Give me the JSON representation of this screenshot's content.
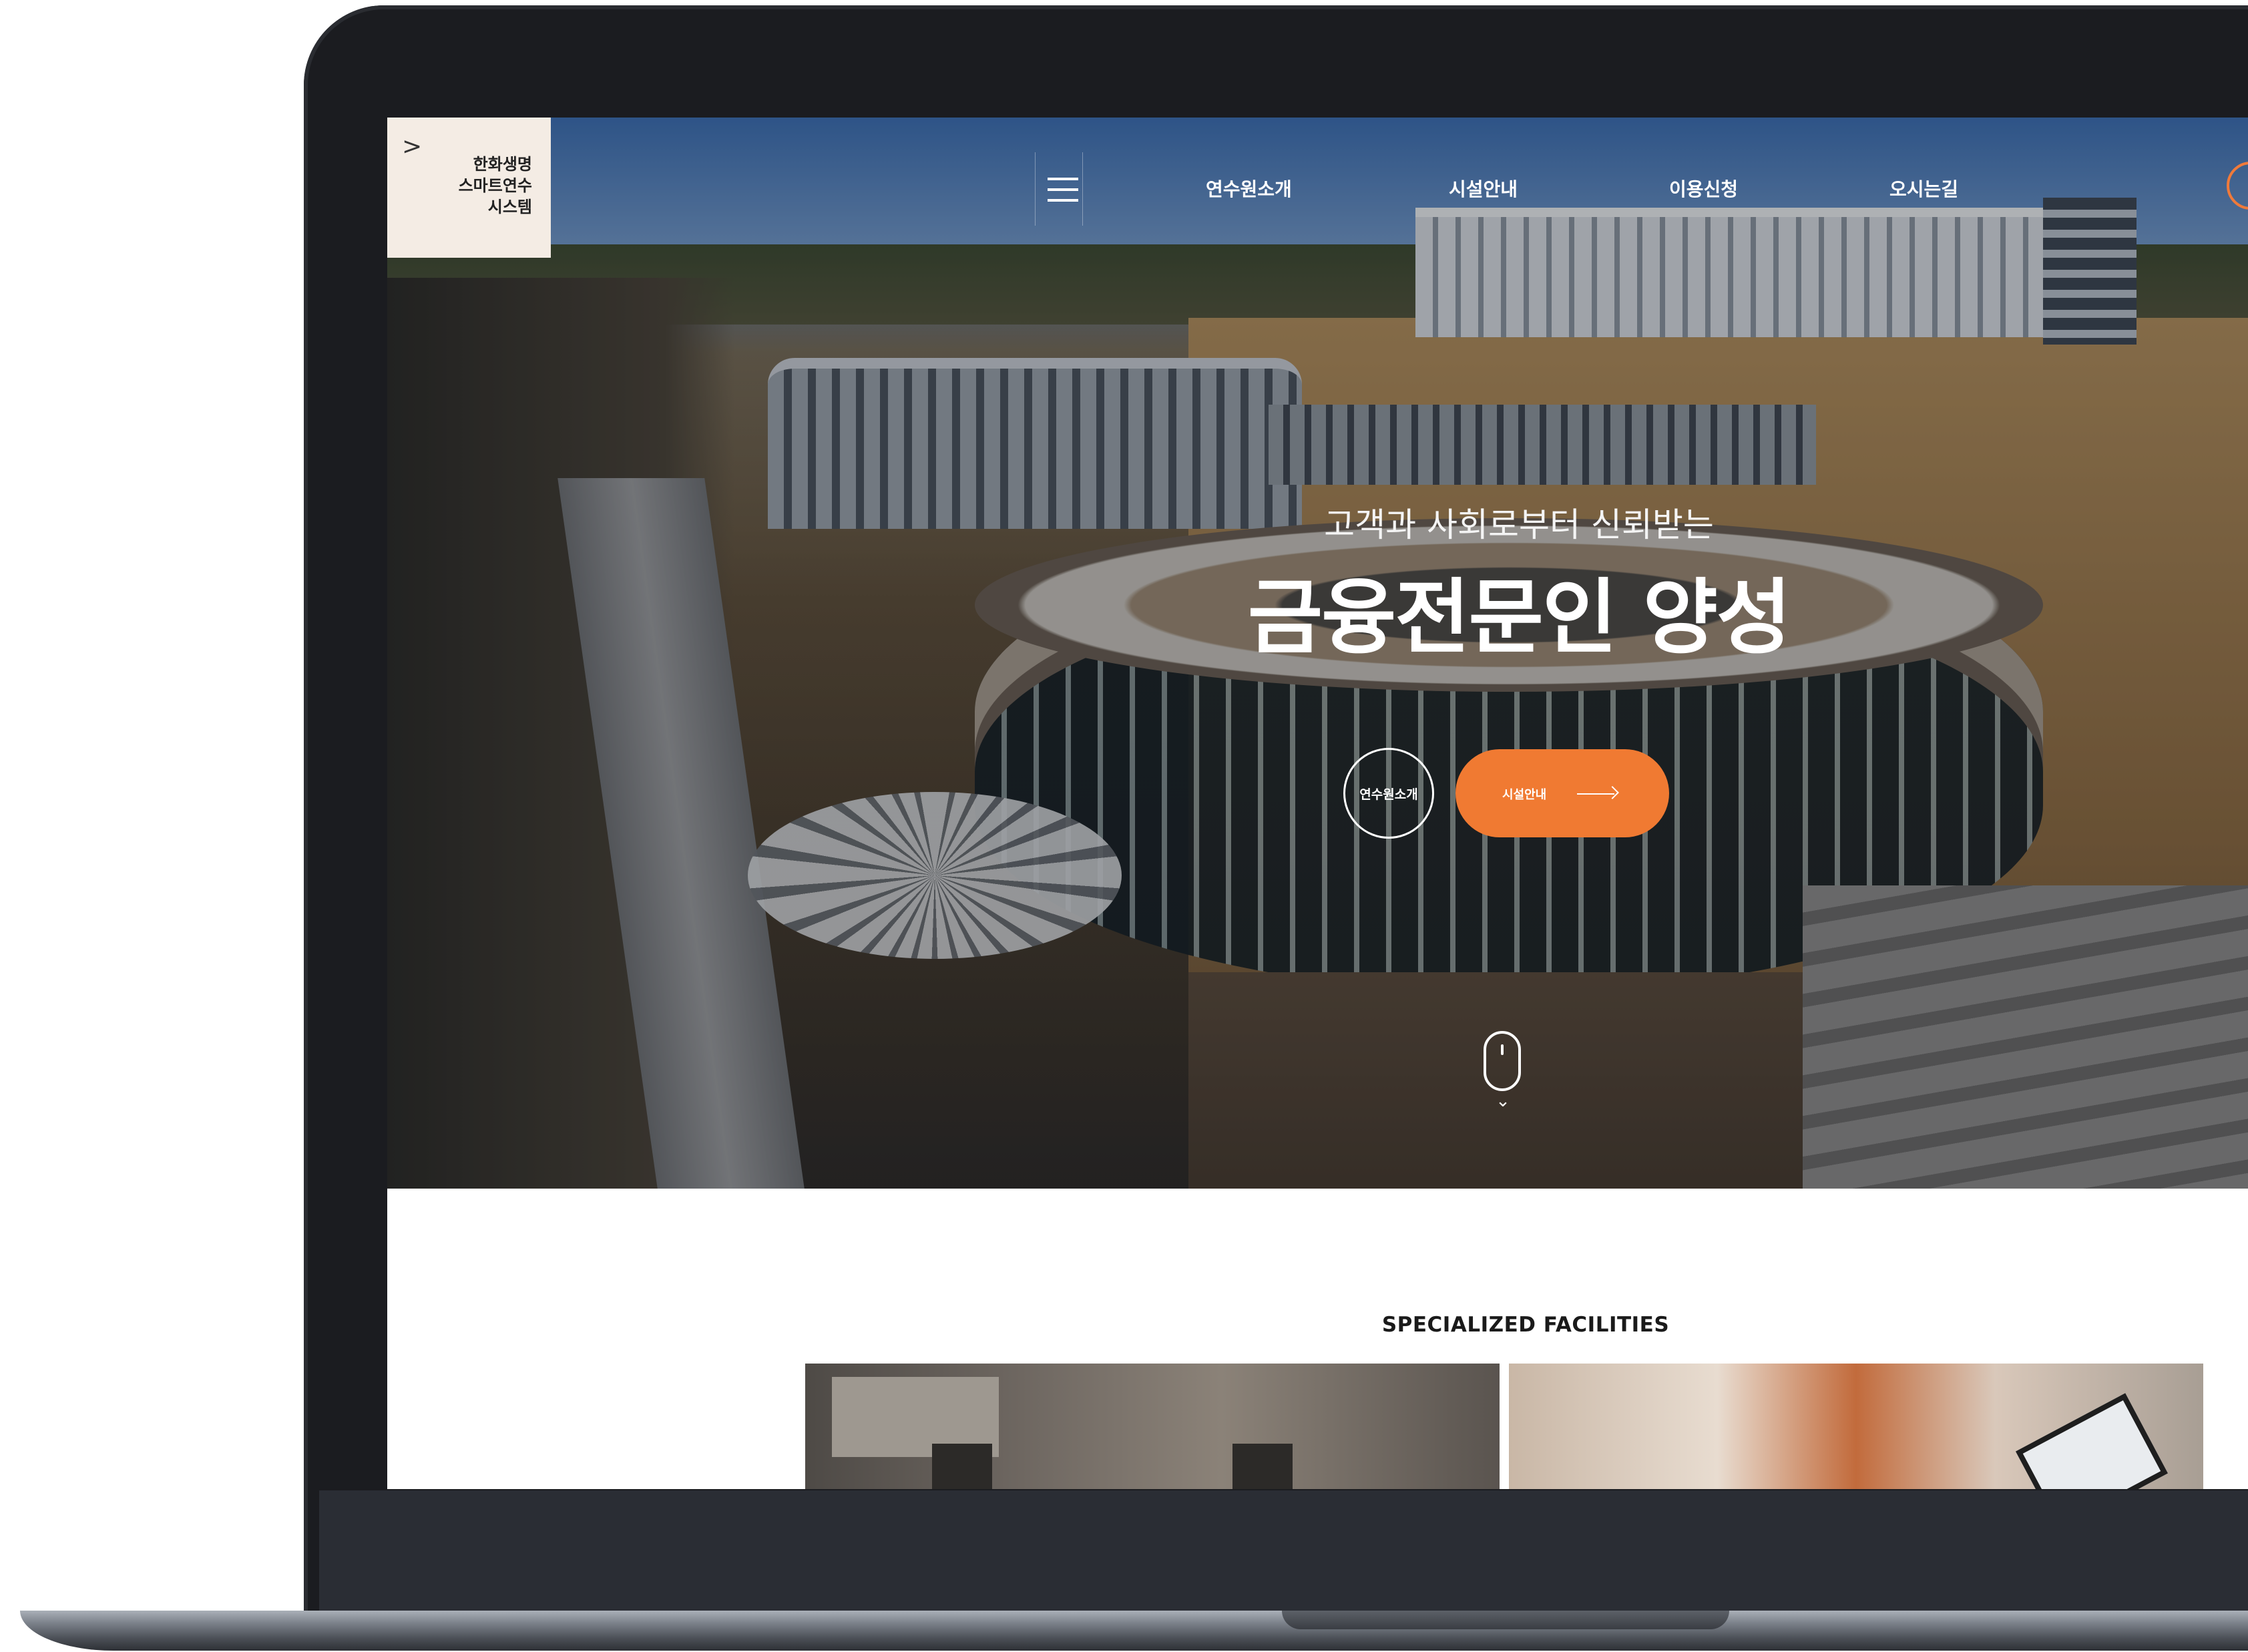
{
  "logo": {
    "text": "한화생명\n스마트연수\n시스템",
    "arrow": ">"
  },
  "nav": {
    "items": [
      "연수원소개",
      "시설안내",
      "이용신청",
      "오시는길"
    ]
  },
  "hero": {
    "subtitle": "고객과 사회로부터 신뢰받는",
    "title": "금융전문인 양성",
    "btn_intro": "연수원소개",
    "btn_facilities": "시설안내"
  },
  "section": {
    "title": "SPECIALIZED FACILITIES"
  },
  "colors": {
    "accent": "#f07a32",
    "logo_bg": "#f4ece4",
    "frame": "#1b1c20"
  }
}
